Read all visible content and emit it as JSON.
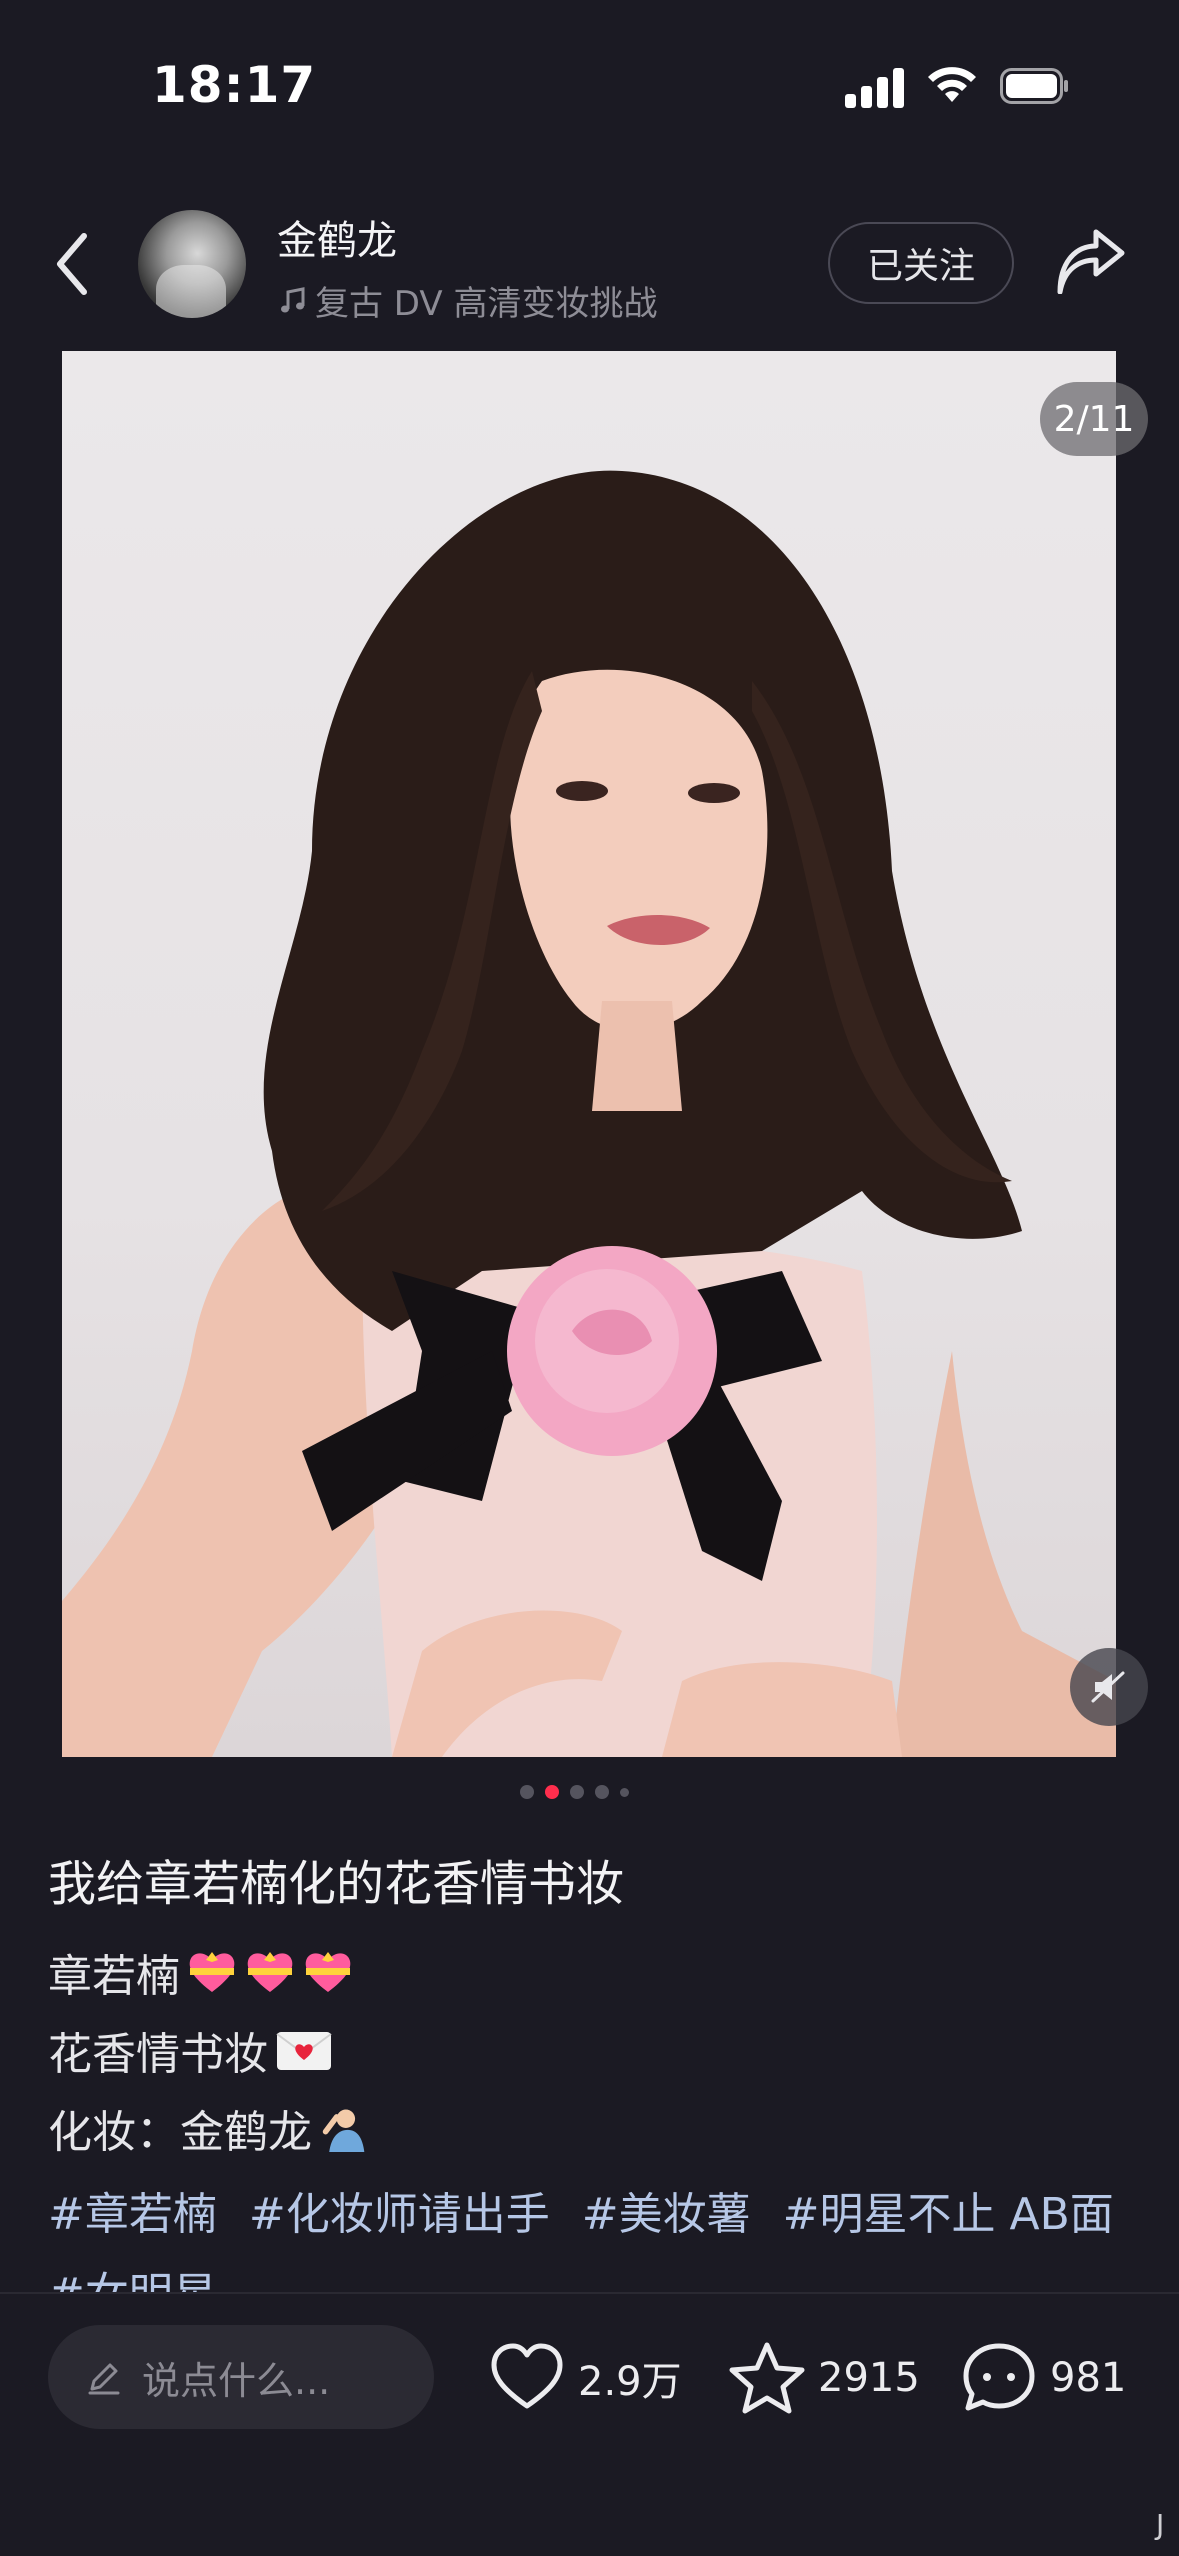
{
  "status_bar": {
    "time": "18:17"
  },
  "header": {
    "user_name": "金鹤龙",
    "music": "复古 DV 高清变妆挑战",
    "follow_label": "已关注"
  },
  "photo": {
    "counter": "2/11"
  },
  "post": {
    "title": "我给章若楠化的花香情书妆",
    "line1": "章若楠",
    "line2": "花香情书妆",
    "line3": "化妆：金鹤龙",
    "tags": [
      "#章若楠",
      "#化妆师请出手",
      "#美妆薯",
      "#明星不止 AB面",
      "#女明星"
    ]
  },
  "bottom": {
    "comment_placeholder": "说点什么...",
    "likes": "2.9万",
    "favorites": "2915",
    "comments": "981",
    "cursor": "J"
  },
  "colors": {
    "background": "#1b1a23",
    "accent": "#ff2e4d",
    "tag": "#b6c7e6"
  },
  "icons": [
    "back-icon",
    "music-note-icon",
    "share-icon",
    "mute-icon",
    "pencil-icon",
    "heart-icon",
    "star-icon",
    "comment-icon"
  ]
}
